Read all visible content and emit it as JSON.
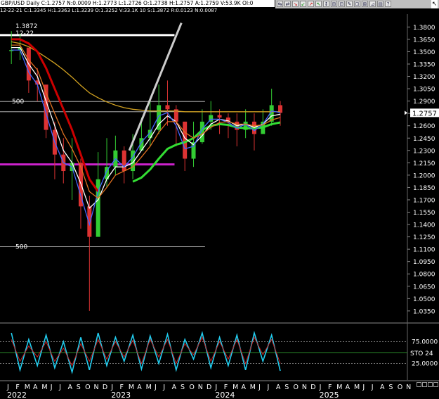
{
  "header": {
    "ohlc_line": "GBP/USD  Daily  C:1.2757  N:0.0009  H:1.2773  L:1.2726  O:1.2738  H:1.2757  A:1.2759  V:53.9K  OI:0",
    "sub_line": "12-22-21  C:1.3345  H:1.3363  L:1.3239  O:1.3252  V:33.1K  10  S:1.3872  R:0.0123  N:0.0087"
  },
  "toolbar": {
    "buttons": [
      "⇆",
      "⇄",
      "↘",
      "↙",
      "↗",
      "↖",
      "↕",
      "⊞",
      "⊟",
      "✎",
      "⊡",
      "⊠",
      "⊿",
      "▤",
      "?"
    ],
    "cursor": "↖"
  },
  "annotations": {
    "high_value": "1.3872",
    "high_date": "12-22",
    "line_label_upper": "500",
    "line_label_lower": "500",
    "stoch_label": "STO 24",
    "stoch_level_75": "75.0000",
    "stoch_level_25": "25.0000"
  },
  "chart_data": [
    {
      "type": "candlestick",
      "title": "GBP/USD Daily",
      "ylim": [
        1.02,
        1.39
      ],
      "price_ticks": [
        "1.3800",
        "1.3650",
        "1.3500",
        "1.3350",
        "1.3200",
        "1.3050",
        "1.2900",
        "1.2750",
        "1.2600",
        "1.2450",
        "1.2300",
        "1.2150",
        "1.2000",
        "1.1850",
        "1.1700",
        "1.1550",
        "1.1400",
        "1.1250",
        "1.1100",
        "1.0950",
        "1.0800",
        "1.0650",
        "1.0500",
        "1.0350"
      ],
      "last_price": "1.2757",
      "month_ticks": [
        "J",
        "F",
        "M",
        "A",
        "M",
        "J",
        "J",
        "A",
        "S",
        "O",
        "N",
        "D",
        "J",
        "F",
        "M",
        "A",
        "M",
        "J",
        "J",
        "A",
        "S",
        "O",
        "N",
        "D",
        "J",
        "F",
        "M",
        "A",
        "M",
        "J",
        "J",
        "A",
        "S",
        "O",
        "N",
        "D",
        "J",
        "F",
        "M",
        "A",
        "M",
        "J",
        "J",
        "A",
        "S",
        "O",
        "N"
      ],
      "year_ticks": [
        "2022",
        "2023",
        "2024",
        "2025"
      ],
      "x_months": [
        0,
        1,
        2,
        3,
        4,
        5,
        6,
        7,
        8,
        9,
        10,
        11,
        12,
        13,
        14,
        15,
        16,
        17,
        18,
        19,
        20,
        21,
        22,
        23,
        24,
        25,
        26,
        27,
        28,
        29,
        30,
        31
      ],
      "close": [
        1.352,
        1.355,
        1.315,
        1.31,
        1.255,
        1.225,
        1.205,
        1.215,
        1.162,
        1.125,
        1.195,
        1.21,
        1.23,
        1.205,
        1.23,
        1.245,
        1.255,
        1.285,
        1.28,
        1.265,
        1.22,
        1.24,
        1.265,
        1.273,
        1.27,
        1.265,
        1.255,
        1.265,
        1.25,
        1.265,
        1.285,
        1.2757
      ],
      "high": [
        1.375,
        1.372,
        1.345,
        1.33,
        1.295,
        1.265,
        1.245,
        1.245,
        1.22,
        1.175,
        1.228,
        1.245,
        1.248,
        1.235,
        1.25,
        1.27,
        1.29,
        1.31,
        1.315,
        1.285,
        1.265,
        1.265,
        1.28,
        1.29,
        1.28,
        1.275,
        1.275,
        1.28,
        1.275,
        1.28,
        1.305,
        1.29
      ],
      "low": [
        1.335,
        1.34,
        1.3,
        1.29,
        1.245,
        1.195,
        1.19,
        1.17,
        1.135,
        1.035,
        1.14,
        1.185,
        1.2,
        1.19,
        1.195,
        1.23,
        1.235,
        1.25,
        1.26,
        1.235,
        1.205,
        1.21,
        1.238,
        1.255,
        1.25,
        1.245,
        1.235,
        1.245,
        1.23,
        1.25,
        1.26,
        1.26
      ],
      "series": [
        {
          "name": "",
          "color": "#d0a020",
          "values": [
            1.362,
            1.36,
            1.356,
            1.35,
            1.343,
            1.336,
            1.328,
            1.319,
            1.309,
            1.3,
            1.294,
            1.289,
            1.285,
            1.282,
            1.28,
            1.279,
            1.278,
            1.278,
            1.278,
            1.278,
            1.277,
            1.277,
            1.277,
            1.277,
            1.277,
            1.277,
            1.277,
            1.277,
            1.277,
            1.277,
            1.277,
            1.277
          ]
        },
        {
          "name": "",
          "color": "#cc0000",
          "values": [
            1.365,
            1.365,
            1.36,
            1.35,
            1.33,
            1.305,
            1.28,
            1.255,
            1.225,
            1.195,
            1.18,
            null,
            null,
            null,
            null,
            null,
            null,
            null,
            null,
            null,
            null,
            null,
            null,
            null,
            null,
            null,
            null,
            null,
            null,
            null,
            null,
            null
          ]
        },
        {
          "name": "",
          "color": "#33dd33",
          "values": [
            null,
            null,
            null,
            null,
            null,
            null,
            null,
            null,
            null,
            null,
            null,
            null,
            null,
            null,
            1.192,
            1.197,
            1.207,
            1.22,
            1.232,
            1.237,
            1.24,
            1.245,
            1.255,
            1.26,
            1.262,
            1.261,
            1.258,
            1.257,
            1.257,
            1.258,
            1.262,
            1.264
          ]
        },
        {
          "name": "",
          "color": "#ffffff",
          "values": [
            1.355,
            1.355,
            1.335,
            1.32,
            1.29,
            1.26,
            1.23,
            1.215,
            1.19,
            1.16,
            1.17,
            1.195,
            1.21,
            1.21,
            1.215,
            1.23,
            1.245,
            1.262,
            1.272,
            1.265,
            1.245,
            1.237,
            1.248,
            1.262,
            1.268,
            1.266,
            1.26,
            1.262,
            1.258,
            1.262,
            1.272,
            1.274
          ]
        },
        {
          "name": "",
          "color": "#4466ff",
          "values": [
            1.352,
            1.352,
            1.325,
            1.31,
            1.275,
            1.24,
            1.215,
            1.21,
            1.175,
            1.14,
            1.18,
            1.205,
            1.22,
            1.21,
            1.222,
            1.24,
            1.252,
            1.272,
            1.276,
            1.26,
            1.232,
            1.235,
            1.256,
            1.268,
            1.268,
            1.264,
            1.257,
            1.262,
            1.254,
            1.262,
            1.278,
            1.276
          ]
        },
        {
          "name": "",
          "color": "#e07020",
          "values": [
            1.358,
            1.358,
            1.34,
            1.328,
            1.3,
            1.275,
            1.25,
            1.232,
            1.21,
            1.18,
            1.172,
            1.185,
            1.2,
            1.205,
            1.21,
            1.222,
            1.235,
            1.252,
            1.265,
            1.265,
            1.252,
            1.245,
            1.25,
            1.258,
            1.264,
            1.265,
            1.262,
            1.262,
            1.26,
            1.261,
            1.267,
            1.27
          ]
        }
      ],
      "horizontal_lines": [
        {
          "value": 1.3702,
          "color": "#ffffff",
          "from": 0,
          "to": 18
        },
        {
          "value": 1.2895,
          "color": "#cccccc",
          "from": 0,
          "to": 22
        },
        {
          "value": 1.277,
          "color": "#cccccc",
          "from": 0,
          "to": 23
        },
        {
          "value": 1.213,
          "color": "#cc22cc",
          "from": 0,
          "to": 18
        },
        {
          "value": 1.113,
          "color": "#cccccc",
          "from": 0,
          "to": 22
        }
      ],
      "trendline": {
        "x": [
          13.6,
          19.6
        ],
        "y": [
          1.23,
          1.385
        ],
        "color": "#cccccc"
      }
    },
    {
      "type": "line",
      "title": "STO 24",
      "ylim": [
        0,
        100
      ],
      "levels": [
        75,
        25
      ],
      "series": [
        {
          "name": "",
          "color": "#22ccee",
          "values": [
            95,
            10,
            80,
            20,
            90,
            15,
            75,
            5,
            85,
            10,
            95,
            20,
            85,
            30,
            90,
            12,
            88,
            25,
            92,
            10,
            80,
            35,
            95,
            15,
            85,
            20,
            90,
            10,
            95,
            30,
            90,
            8
          ]
        },
        {
          "name": "",
          "color": "#cc2222",
          "values": [
            80,
            30,
            65,
            40,
            75,
            30,
            60,
            20,
            70,
            30,
            80,
            35,
            75,
            40,
            78,
            25,
            80,
            40,
            80,
            25,
            70,
            45,
            85,
            30,
            75,
            35,
            80,
            25,
            85,
            45,
            80,
            25
          ]
        }
      ]
    }
  ]
}
